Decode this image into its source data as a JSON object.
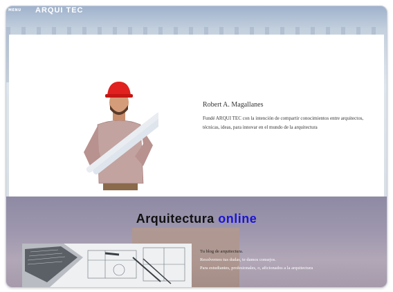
{
  "header": {
    "menu_label": "MENU",
    "brand": "ARQUI TEC"
  },
  "profile": {
    "name": "Robert A. Magallanes",
    "text": "Fundé ARQUI TEC con la intención de compartir conocimientos entre arquitectos, técnicas, ideas, para innovar en el mundo de la arquitectura"
  },
  "section2": {
    "title_main": "Arquitectura",
    "title_accent": "online",
    "lines": [
      "Tu blog de arquitectura.",
      "Resolvemos tus dudas, te damos consejos.",
      "Para estudiantes, profesionales, o, aficionados a la arquitectura"
    ]
  },
  "colors": {
    "accent": "#1a14d6",
    "helmet": "#e0211f"
  }
}
